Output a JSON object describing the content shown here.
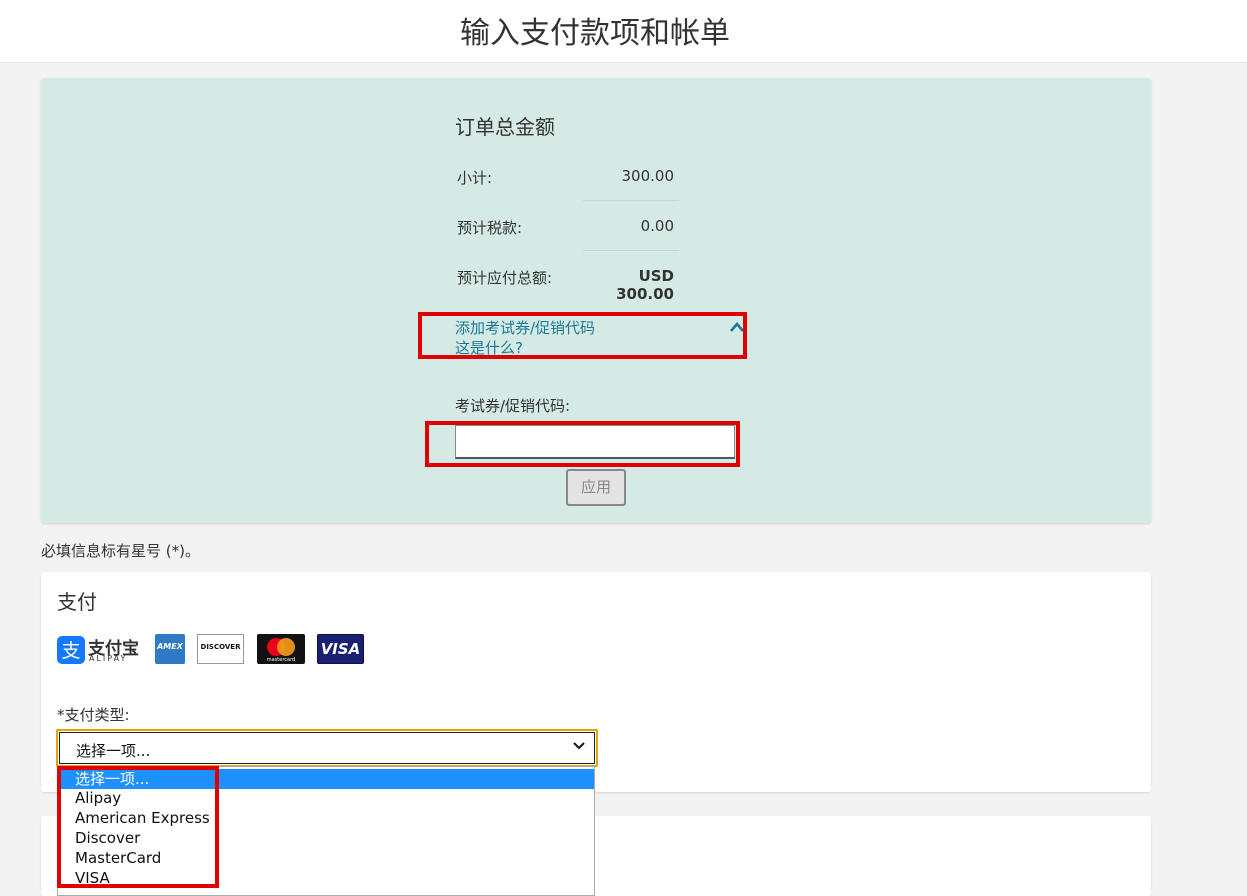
{
  "header": {
    "title": "输入支付款项和帐单"
  },
  "order": {
    "heading": "订单总金额",
    "subtotal_label": "小计:",
    "subtotal_value": "300.00",
    "tax_label": "预计税款:",
    "tax_value": "0.00",
    "total_label": "预计应付总额:",
    "total_value": "USD 300.00",
    "promo_toggle": "添加考试券/促销代码",
    "promo_help": "这是什么?",
    "promo_field_label": "考试券/促销代码:",
    "promo_field_value": "",
    "apply_button": "应用"
  },
  "required_note": "必填信息标有星号 (*)。",
  "payment": {
    "title": "支付",
    "logos": [
      "alipay-logo",
      "amex-logo",
      "discover-logo",
      "mastercard-logo",
      "visa-logo"
    ],
    "alipay_cn": "支付宝",
    "alipay_en": "ALIPAY",
    "amex_text": "AMEX",
    "discover_text": "DISCOVER",
    "mastercard_text": "mastercard",
    "visa_text": "VISA",
    "type_label": "*支付类型:",
    "type_selected": "选择一项...",
    "options": [
      "选择一项...",
      "Alipay",
      "American Express",
      "Discover",
      "MasterCard",
      "VISA"
    ]
  },
  "colors": {
    "panel_bg": "#d5eae4",
    "link": "#1b7a9a",
    "highlight_box": "#e00000",
    "select_focus": "#e8a300",
    "option_selected_bg": "#1e90ff"
  }
}
